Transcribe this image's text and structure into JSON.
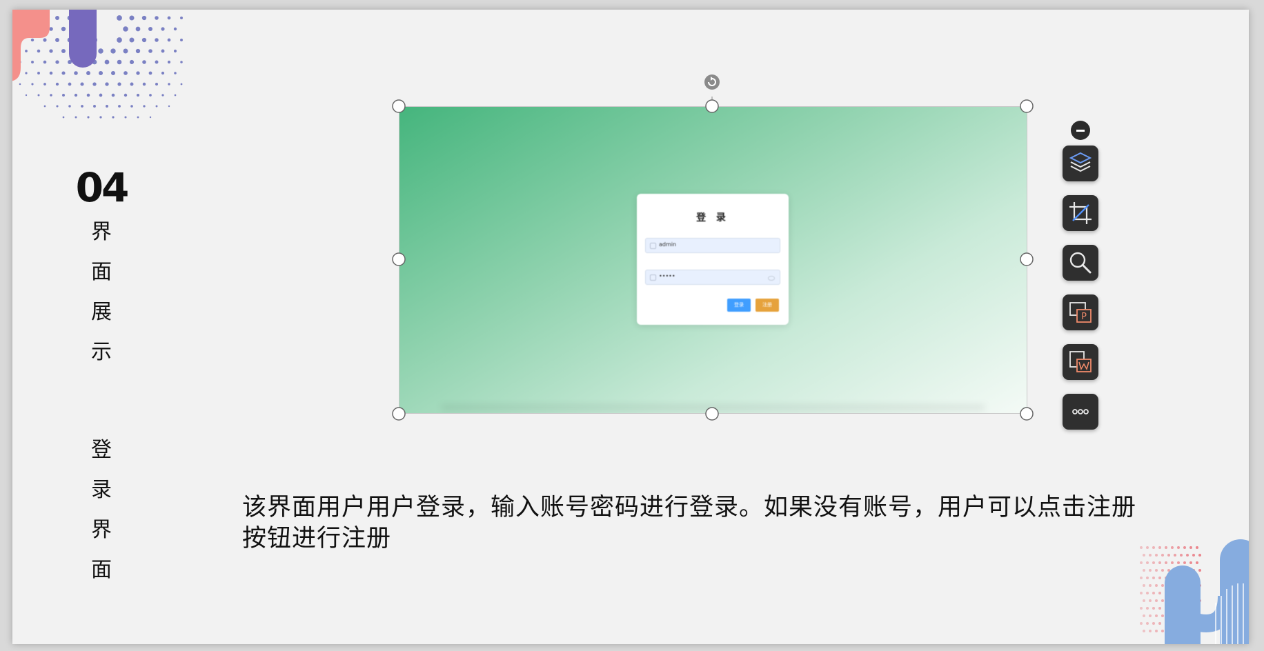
{
  "slide": {
    "section_number": "04",
    "section_title": "界\n面\n展\n示",
    "subsection_title": "登\n录\n界\n面",
    "caption": "该界面用户用户登录，输入账号密码进行登录。如果没有账号，用户可以点击注册按钮进行注册"
  },
  "embedded_screenshot": {
    "login_title": "登 录",
    "username_value": "admin",
    "password_value": "•••••",
    "login_button": "登录",
    "register_button": "注册"
  },
  "toolbar": {
    "icons": [
      "collapse-icon",
      "layers-icon",
      "crop-icon",
      "search-icon",
      "image-to-ppt-icon",
      "image-to-word-icon",
      "more-icon"
    ]
  },
  "colors": {
    "slide_background": "#f2f2f2",
    "accent_green": "#45b57d",
    "login_blue": "#409eff",
    "register_orange": "#e6a23c",
    "deco_purple": "#7b6fbf",
    "deco_salmon": "#f28c86",
    "deco_blue": "#7aa6dc"
  }
}
